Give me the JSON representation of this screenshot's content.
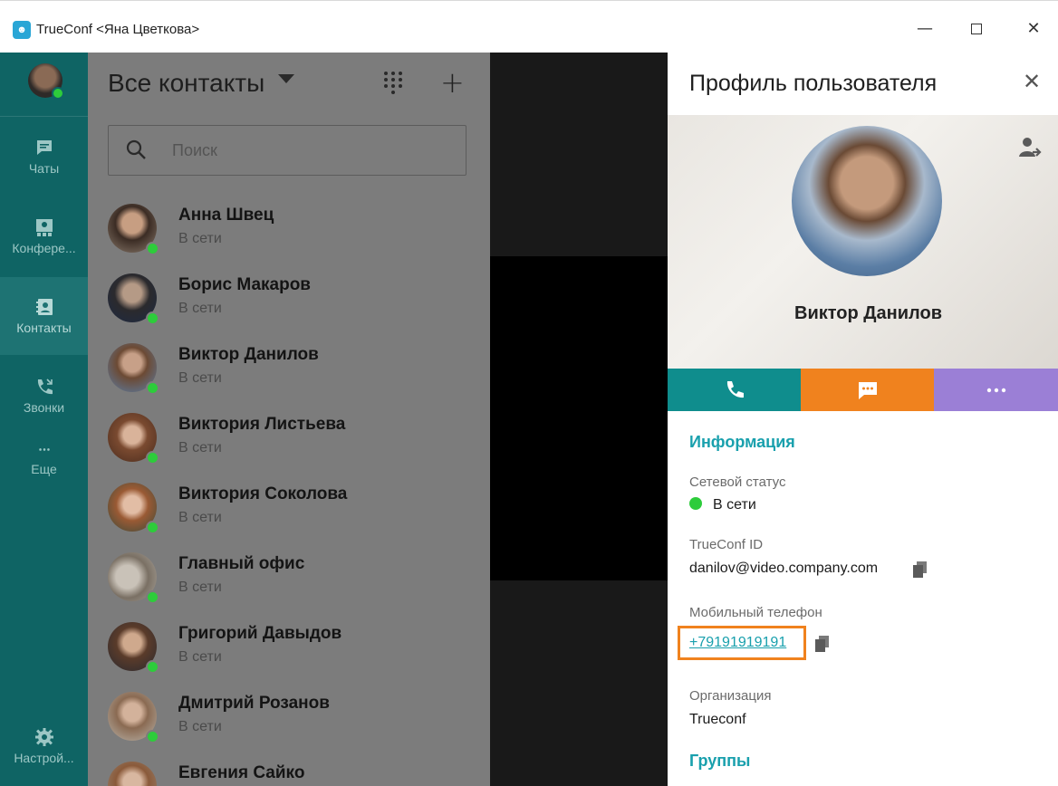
{
  "window": {
    "title": "TrueConf <Яна Цветкова>",
    "logo": "trueconf-logo-icon"
  },
  "nav": {
    "items": [
      {
        "label": "Чаты",
        "icon": "chat-icon"
      },
      {
        "label": "Конфере...",
        "icon": "conference-icon"
      },
      {
        "label": "Контакты",
        "icon": "contacts-icon",
        "active": true
      },
      {
        "label": "Звонки",
        "icon": "calls-icon"
      },
      {
        "label": "Еще",
        "icon": "more-dots-icon"
      }
    ],
    "settings_label": "Настрой..."
  },
  "contacts": {
    "title": "Все контакты",
    "search_placeholder": "Поиск",
    "list": [
      {
        "name": "Анна Швец",
        "status": "В сети"
      },
      {
        "name": "Борис Макаров",
        "status": "В сети"
      },
      {
        "name": "Виктор Данилов",
        "status": "В сети"
      },
      {
        "name": "Виктория Листьева",
        "status": "В сети"
      },
      {
        "name": "Виктория Соколова",
        "status": "В сети"
      },
      {
        "name": "Главный офис",
        "status": "В сети"
      },
      {
        "name": "Григорий Давыдов",
        "status": "В сети"
      },
      {
        "name": "Дмитрий Розанов",
        "status": "В сети"
      },
      {
        "name": "Евгения Сайко",
        "status": ""
      }
    ]
  },
  "profile": {
    "title": "Профиль пользователя",
    "name": "Виктор Данилов",
    "info_section": "Информация",
    "network_status_label": "Сетевой статус",
    "network_status_value": "В сети",
    "trueconf_id_label": "TrueConf ID",
    "trueconf_id_value": "danilov@video.company.com",
    "mobile_label": "Мобильный телефон",
    "mobile_value": "+79191919191",
    "organization_label": "Организация",
    "organization_value": "Trueconf",
    "groups_section": "Группы"
  },
  "colors": {
    "nav_bg": "#0f6464",
    "accent_teal": "#19a0ad",
    "call_btn": "#0f8d8d",
    "chat_btn": "#f0821e",
    "more_btn": "#9b7fd6",
    "online": "#2dcc3b",
    "highlight": "#f0821e"
  }
}
